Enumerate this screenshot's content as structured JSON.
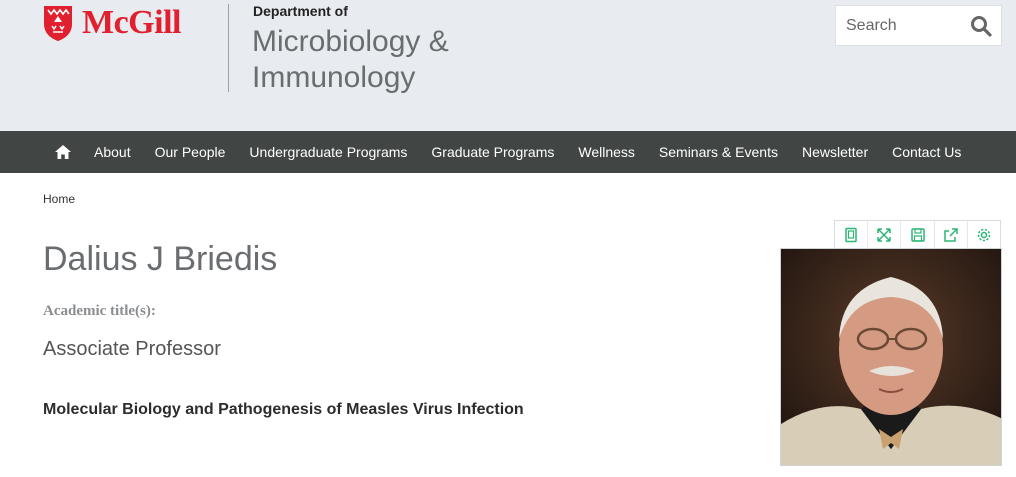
{
  "header": {
    "logo_text": "McGill",
    "dept_small": "Department of",
    "dept_line1": "Microbiology &",
    "dept_line2": "Immunology",
    "search_placeholder": "Search"
  },
  "nav": {
    "home_icon": "home-icon",
    "items": [
      "About",
      "Our People",
      "Undergraduate Programs",
      "Graduate Programs",
      "Wellness",
      "Seminars & Events",
      "Newsletter",
      "Contact Us"
    ]
  },
  "breadcrumb": "Home",
  "toolbar": {
    "icons": [
      "bookmark-icon",
      "expand-icon",
      "save-icon",
      "share-icon",
      "settings-icon"
    ]
  },
  "profile": {
    "name": "Dalius J Briedis",
    "academic_label": "Academic title(s):",
    "academic_title": "Associate Professor",
    "research": "Molecular Biology and Pathogenesis of Measles Virus Infection"
  },
  "colors": {
    "brand_red": "#e0202e",
    "nav_bg": "#414544",
    "header_bg": "#e8ebef",
    "toolbar_green": "#2bb673"
  }
}
